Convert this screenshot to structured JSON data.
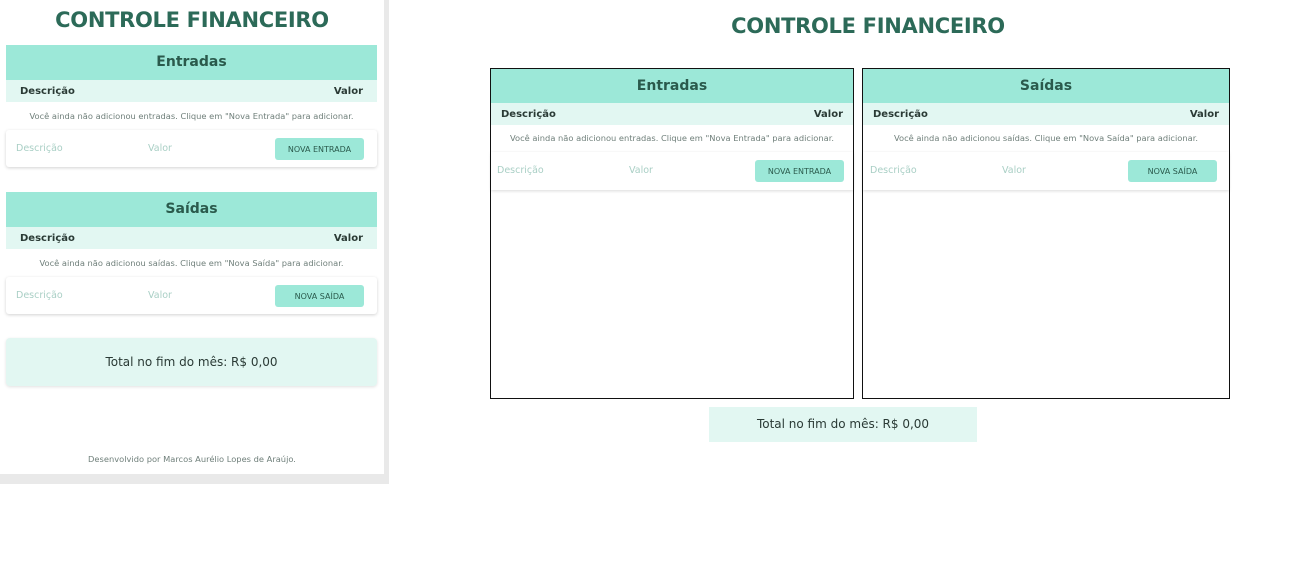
{
  "app": {
    "title": "CONTROLE FINANCEIRO"
  },
  "entradas": {
    "heading": "Entradas",
    "col_description": "Descrição",
    "col_value": "Valor",
    "empty_message": "Você ainda não adicionou entradas. Clique em \"Nova Entrada\" para adicionar.",
    "description_placeholder": "Descrição",
    "value_placeholder": "Valor",
    "add_button": "NOVA ENTRADA"
  },
  "saidas": {
    "heading": "Saídas",
    "col_description": "Descrição",
    "col_value": "Valor",
    "empty_message": "Você ainda não adicionou saídas. Clique em \"Nova Saída\" para adicionar.",
    "description_placeholder": "Descrição",
    "value_placeholder": "Valor",
    "add_button": "NOVA SAÍDA"
  },
  "total": {
    "label": "Total no fim do mês: R$ 0,00"
  },
  "footer": {
    "credit": "Desenvolvido por Marcos Aurélio Lopes de Araújo."
  },
  "colors": {
    "accent": "#9ce8d8",
    "accent_light": "#e2f7f2",
    "title": "#2c6a58"
  }
}
